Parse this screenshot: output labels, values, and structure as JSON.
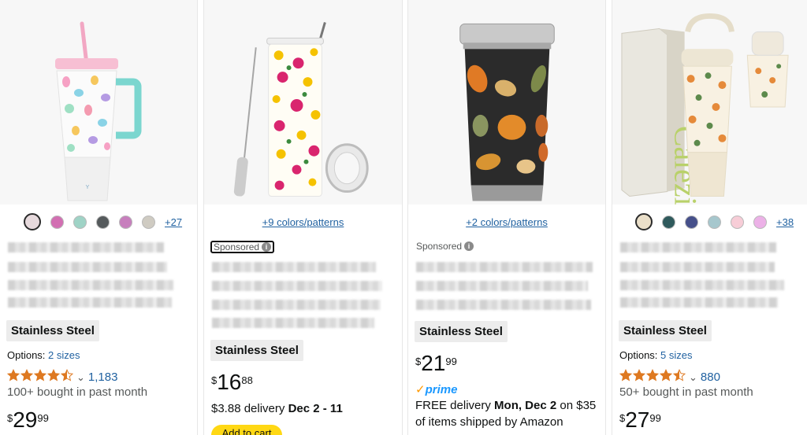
{
  "products": [
    {
      "swatch_colors": [
        "#e7dadd",
        "#d26fb2",
        "#9fd3c6",
        "#555a5c",
        "#c77fbd",
        "#cfcbc2"
      ],
      "more_colors": "+27",
      "badge": "Stainless Steel",
      "options_label": "Options:",
      "options_value": "2 sizes",
      "rating_stars": 4.5,
      "rating_count": "1,183",
      "bought": "100+ bought in past month",
      "price_symbol": "$",
      "price_whole": "29",
      "price_fraction": "99"
    },
    {
      "colors_link": "+9 colors/patterns",
      "sponsored": "Sponsored",
      "badge": "Stainless Steel",
      "price_symbol": "$",
      "price_whole": "16",
      "price_fraction": "88",
      "delivery_prefix": "$3.88 delivery",
      "delivery_dates": "Dec 2 - 11",
      "add_to_cart": "Add to cart"
    },
    {
      "colors_link": "+2 colors/patterns",
      "sponsored": "Sponsored",
      "badge": "Stainless Steel",
      "price_symbol": "$",
      "price_whole": "21",
      "price_fraction": "99",
      "prime_label": "prime",
      "free_delivery_prefix": "FREE delivery",
      "free_delivery_date": "Mon, Dec 2",
      "free_delivery_suffix": "on $35",
      "shipped_by": "of items shipped by Amazon"
    },
    {
      "swatch_colors": [
        "#eadfc9",
        "#2f5a5c",
        "#46508a",
        "#a6c7cd",
        "#f7cdd7",
        "#ecb1e7"
      ],
      "more_colors": "+38",
      "badge": "Stainless Steel",
      "options_label": "Options:",
      "options_value": "5 sizes",
      "rating_stars": 4.5,
      "rating_count": "880",
      "bought": "50+ bought in past month",
      "price_symbol": "$",
      "price_whole": "27",
      "price_fraction": "99"
    }
  ],
  "colors": {
    "star": "#de7921",
    "link": "#2162a1",
    "cart": "#ffd814",
    "prime": "#1a98ff"
  },
  "icons": [
    "star-icon",
    "half-star-icon",
    "chevron-down-icon",
    "info-icon",
    "prime-check-icon"
  ]
}
